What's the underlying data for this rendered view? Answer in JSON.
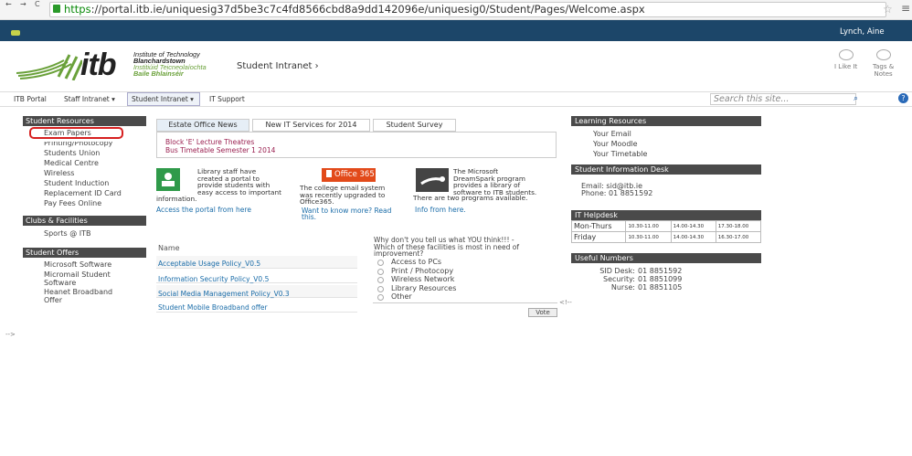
{
  "browser": {
    "url_scheme": "https",
    "url_rest": "://portal.itb.ie/uniquesig37d5be3c7c4fd8566cbd8a9dd142096e/uniquesig0/Student/Pages/Welcome.aspx"
  },
  "suite": {
    "user": "Lynch, Aine"
  },
  "header": {
    "logo": "itb",
    "inst_line1": "Institute of Technology",
    "inst_line2": "Blanchardstown",
    "inst_line3": "Institiúid Teicneolaíochta",
    "inst_line4": "Baile Bhlainséir",
    "breadcrumb": "Student Intranet ›",
    "like_label": "I Like It",
    "tags_label1": "Tags &",
    "tags_label2": "Notes"
  },
  "topnav": {
    "items": [
      "ITB Portal",
      "Staff Intranet ▾",
      "Student Intranet ▾",
      "IT Support"
    ],
    "search_placeholder": "Search this site..."
  },
  "left": {
    "resources_title": "Student Resources",
    "resources": [
      "Exam Papers",
      "Printing/Photocopy",
      "Students Union",
      "Medical Centre",
      "Wireless",
      "Student Induction",
      "Replacement ID Card",
      "Pay Fees Online"
    ],
    "clubs_title": "Clubs & Facilities",
    "clubs": [
      "Sports @ ITB"
    ],
    "offers_title": "Student Offers",
    "offers": [
      "Microsoft Software",
      "Micromail Student",
      "Software",
      "Heanet Broadband",
      "Offer"
    ]
  },
  "tabs": [
    "Estate Office News",
    "New IT Services for 2014",
    "Student Survey"
  ],
  "news": [
    "Block 'E' Lecture Theatres",
    "Bus Timetable Semester 1 2014"
  ],
  "promo": {
    "p1_l1": "Library staff have",
    "p1_l2": "created a portal to",
    "p1_l3": "provide students with",
    "p1_l4": "easy access to important",
    "p1_l5": "information.",
    "p1_link": "Access the portal from here",
    "office": "Office 365",
    "p2_l1": "The college email system",
    "p2_l2": "was recently upgraded to",
    "p2_l3": "Office365.",
    "p2_link1": "Want to know more? Read",
    "p2_link2": "this.",
    "p3_l1": "The Microsoft",
    "p3_l2": "DreamSpark program",
    "p3_l3": "provides a library of",
    "p3_l4": "software to ITB students.",
    "p3_l5": "There are two programs available.",
    "p3_link": "Info from here."
  },
  "docs": {
    "header": "Name",
    "items": [
      "Acceptable Usage Policy_V0.5",
      "Information Security Policy_V0.5",
      "Social Media Management Policy_V0.3",
      "Student Mobile Broadband offer"
    ]
  },
  "survey": {
    "q1": "Why don't you tell us what YOU think!!! -",
    "q2": "Which of these facilities is most in need of",
    "q3": "improvement?",
    "options": [
      "Access to PCs",
      "Print / Photocopy",
      "Wireless Network",
      "Library Resources",
      "Other"
    ],
    "vote": "Vote",
    "stray": "<!--"
  },
  "learning": {
    "title": "Learning Resources",
    "items": [
      "Your Email",
      "Your Moodle",
      "Your Timetable"
    ]
  },
  "desk": {
    "title": "Student Information Desk",
    "email": "Email: sid@itb.ie",
    "phone": "Phone: 01 8851592"
  },
  "helpdesk": {
    "title": "IT Helpdesk",
    "rows": [
      {
        "day": "Mon-Thurs",
        "s1": "10.30-11.00",
        "s2": "14.00-14.30",
        "s3": "17.30-18.00"
      },
      {
        "day": "Friday",
        "s1": "10.30-11.00",
        "s2": "14.00-14.30",
        "s3": "16.30-17.00"
      }
    ]
  },
  "numbers": {
    "title": "Useful Numbers",
    "rows": [
      {
        "label": "SID Desk:",
        "value": "01 8851592"
      },
      {
        "label": "Security:",
        "value": "01 8851099"
      },
      {
        "label": "Nurse:",
        "value": "01 8851105"
      }
    ]
  },
  "footer_stray": "-->"
}
